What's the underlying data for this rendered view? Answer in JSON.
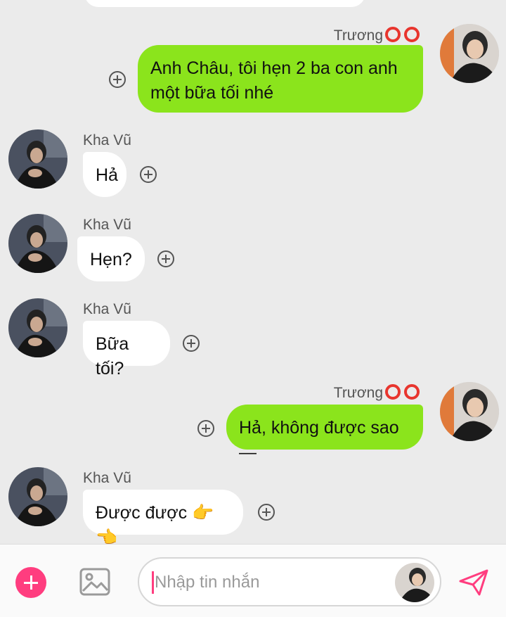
{
  "messages": [
    {
      "side": "out",
      "sender": "Trương",
      "text": "Anh Châu, tôi hẹn 2 ba con anh một bữa tối nhé"
    },
    {
      "side": "in",
      "sender": "Kha Vũ",
      "text": "Hả"
    },
    {
      "side": "in",
      "sender": "Kha Vũ",
      "text": "Hẹn?"
    },
    {
      "side": "in",
      "sender": "Kha Vũ",
      "text": "Bữa tối?"
    },
    {
      "side": "out",
      "sender": "Trương",
      "text": "Hả, không được sao—"
    },
    {
      "side": "in",
      "sender": "Kha Vũ",
      "text": "Được được 👉👈"
    }
  ],
  "composer": {
    "placeholder": "Nhập tin nhắn"
  },
  "colors": {
    "outgoing_bubble": "#8be41c",
    "incoming_bubble": "#ffffff",
    "accent": "#ff3d7f",
    "background": "#ebebeb",
    "rings": "#e8352e"
  }
}
